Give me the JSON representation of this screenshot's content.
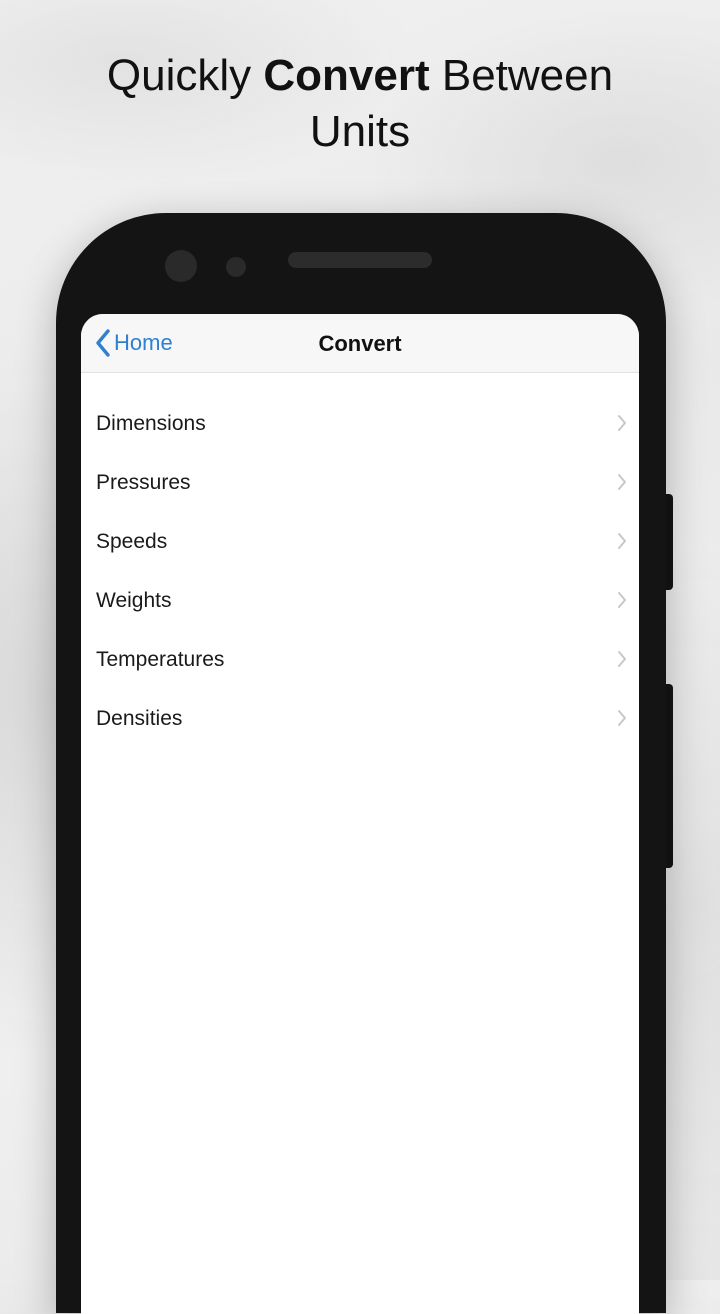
{
  "headline": {
    "prefix": "Quickly ",
    "bold": "Convert",
    "suffix": " Between",
    "line2": "Units"
  },
  "navbar": {
    "back_label": "Home",
    "title": "Convert"
  },
  "colors": {
    "accent": "#2f80d1",
    "chevron": "#c7c7cc"
  },
  "list": {
    "items": [
      {
        "label": "Dimensions"
      },
      {
        "label": "Pressures"
      },
      {
        "label": "Speeds"
      },
      {
        "label": "Weights"
      },
      {
        "label": "Temperatures"
      },
      {
        "label": "Densities"
      }
    ]
  }
}
